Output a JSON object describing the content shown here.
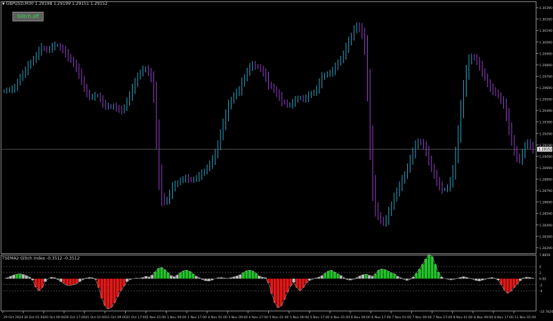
{
  "header": {
    "symbol_line": "GBPUSD,M30  1.29198 1.29199 1.29151 1.29152"
  },
  "button": {
    "label": "Glitch off",
    "color": "#2fe04a"
  },
  "indicator": {
    "title": "TSEMA2 Glitch Index -0.3512 -0.3512"
  },
  "price_axis": {
    "labels": [
      "1.30390",
      "1.30290",
      "1.30190",
      "1.30090",
      "1.29990",
      "1.29890",
      "1.29790",
      "1.29690",
      "1.29590",
      "1.29490",
      "1.29390",
      "1.29290",
      "1.29190",
      "1.29090",
      "1.28990",
      "1.28890",
      "1.28790",
      "1.28690",
      "1.28590",
      "1.28490",
      "1.28390",
      "1.28290"
    ],
    "current_price": "1.29152"
  },
  "indicator_axis": {
    "labels": [
      "7.8859",
      "4",
      "2",
      "0.00",
      "-2",
      "-4",
      "-10.7826"
    ]
  },
  "time_axis": {
    "labels": [
      "29 Oct 2024",
      "30 Oct 01:00",
      "30 Oct 09:00",
      "30 Oct 17:00",
      "31 Oct 01:00",
      "31 Oct 09:00",
      "31 Oct 17:00",
      "1 Nov 01:00",
      "1 Nov 09:00",
      "1 Nov 17:00",
      "4 Nov 01:00",
      "4 Nov 09:00",
      "4 Nov 17:00",
      "5 Nov 01:00",
      "5 Nov 09:00",
      "5 Nov 17:00",
      "6 Nov 01:00",
      "6 Nov 09:00",
      "6 Nov 17:00",
      "7 Nov 01:00",
      "7 Nov 09:00",
      "7 Nov 17:00",
      "8 Nov 01:00",
      "8 Nov 09:00",
      "8 Nov 17:00",
      "11 Nov 01:00"
    ]
  },
  "colors": {
    "up": "#2aa7c8",
    "down": "#9a3fd0",
    "pos": "#22c22a",
    "neg": "#e01818",
    "grid": "#6a6a6a"
  },
  "chart_data": [
    {
      "type": "bar",
      "title": "GBPUSD,M30",
      "series": [
        {
          "values": [
            1.2966,
            1.2967,
            1.2967,
            1.2968,
            1.2969,
            1.2974,
            1.2978,
            1.2981,
            1.2984,
            1.2988,
            1.2991,
            1.2994,
            1.2997,
            1.3001,
            1.3004,
            1.3003,
            1.3002,
            1.3003,
            1.3005,
            1.3006,
            1.3006,
            1.3004,
            1.3002,
            1.2999,
            1.2996,
            1.2993,
            1.299,
            1.2986,
            1.2981,
            1.2976,
            1.2969,
            1.2964,
            1.2961,
            1.2961,
            1.2962,
            1.2962,
            1.2959,
            1.2955,
            1.2953,
            1.2953,
            1.2952,
            1.2953,
            1.2951,
            1.295,
            1.2949,
            1.2952,
            1.2957,
            1.2962,
            1.2968,
            1.2973,
            1.2979,
            1.2982,
            1.2985,
            1.2985,
            1.2983,
            1.2977,
            1.2962,
            1.2928,
            1.2893,
            1.2874,
            1.2869,
            1.2871,
            1.2876,
            1.2882,
            1.2884,
            1.2886,
            1.2888,
            1.2889,
            1.289,
            1.2889,
            1.2888,
            1.2889,
            1.289,
            1.2892,
            1.2894,
            1.2896,
            1.2899,
            1.2902,
            1.2906,
            1.2911,
            1.2919,
            1.2928,
            1.2937,
            1.2945,
            1.2953,
            1.2958,
            1.2962,
            1.2965,
            1.2967,
            1.2973,
            1.2978,
            1.2983,
            1.2987,
            1.2989,
            1.2988,
            1.2987,
            1.2985,
            1.2982,
            1.2978,
            1.2972,
            1.297,
            1.2967,
            1.2964,
            1.2961,
            1.2957,
            1.2956,
            1.2954,
            1.2954,
            1.2956,
            1.2958,
            1.296,
            1.296,
            1.2959,
            1.296,
            1.2962,
            1.2964,
            1.2965,
            1.2968,
            1.2973,
            1.2978,
            1.298,
            1.2981,
            1.2982,
            1.2984,
            1.2987,
            1.2991,
            1.2994,
            1.2998,
            1.3004,
            1.3009,
            1.3014,
            1.302,
            1.3023,
            1.3021,
            1.3016,
            1.3003,
            1.2969,
            1.2922,
            1.2884,
            1.2865,
            1.2857,
            1.2853,
            1.2851,
            1.2854,
            1.286,
            1.2866,
            1.2873,
            1.2878,
            1.2883,
            1.2888,
            1.2893,
            1.2899,
            1.2906,
            1.2912,
            1.2918,
            1.2922,
            1.2921,
            1.2918,
            1.2913,
            1.2906,
            1.2899,
            1.2893,
            1.2887,
            1.2883,
            1.288,
            1.288,
            1.2882,
            1.2887,
            1.2896,
            1.291,
            1.2929,
            1.295,
            1.2968,
            1.2982,
            1.2992,
            1.2996,
            1.2995,
            1.2992,
            1.2988,
            1.2983,
            1.2978,
            1.2973,
            1.2969,
            1.2966,
            1.2965,
            1.2962,
            1.2958,
            1.2954,
            1.2945,
            1.2934,
            1.2923,
            1.2914,
            1.2908,
            1.2906,
            1.2911,
            1.2918,
            1.2921,
            1.2918,
            1.2915
          ]
        }
      ]
    },
    {
      "type": "bar",
      "title": "TSEMA2 Glitch Index",
      "series": [
        {
          "values": [
            0,
            0.3,
            0.8,
            1.2,
            1.5,
            1.6,
            1.4,
            1.0,
            0.5,
            -0.5,
            -2.8,
            -4.0,
            -3.0,
            -1.0,
            0,
            0.5,
            0.3,
            -0.3,
            -1.0,
            -1.6,
            -2.2,
            -2.2,
            -2.0,
            -1.6,
            -1.0,
            -0.3,
            0.2,
            0.4,
            0.3,
            -0.3,
            -3.0,
            -6.5,
            -9.0,
            -10.0,
            -9.5,
            -8.0,
            -6.0,
            -4.0,
            -2.5,
            -1.0,
            -0.3,
            0,
            0.2,
            0.1,
            0.4,
            0.8,
            0.5,
            1.2,
            2.3,
            3.4,
            3.7,
            3.0,
            2.0,
            1.0,
            0.6,
            1.2,
            2.0,
            2.6,
            2.8,
            2.4,
            1.6,
            0.8,
            0.3,
            -0.3,
            -0.7,
            -0.8,
            -0.5,
            0,
            0.3,
            0.4,
            0.2,
            0.1,
            0.3,
            0.6,
            0.9,
            1.3,
            2.0,
            2.6,
            2.8,
            2.5,
            1.8,
            0.9,
            0.5,
            0.3,
            -1.5,
            -5.0,
            -8.0,
            -9.6,
            -9.0,
            -7.0,
            -4.5,
            -2.5,
            -1.2,
            -3.0,
            -4.0,
            -3.0,
            -1.5,
            -0.6,
            -0.2,
            0.2,
            0.5,
            1.0,
            1.8,
            2.5,
            2.8,
            2.2,
            1.6,
            1.0,
            0.3,
            -0.3,
            -0.5,
            -0.2,
            0.3,
            0.9,
            1.3,
            1.5,
            1.1,
            0.8,
            1.6,
            2.8,
            3.2,
            3.0,
            2.5,
            2.0,
            1.6,
            0.8,
            0.3,
            -0.2,
            -0.6,
            -0.2,
            0.6,
            1.8,
            3.2,
            4.8,
            6.5,
            8.0,
            7.3,
            4.8,
            2.2,
            0.6,
            0,
            -0.2,
            -0.4,
            -0.2,
            0.1,
            0.4,
            0.7,
            0.4,
            0.1,
            -0.2,
            -0.6,
            -0.8,
            -0.5,
            -0.2,
            0.2,
            0.4,
            0.1,
            -0.5,
            -2.0,
            -3.8,
            -4.8,
            -4.2,
            -3.0,
            -1.8,
            -0.7,
            0.2,
            0.5,
            0.4,
            0.2
          ]
        }
      ]
    }
  ]
}
